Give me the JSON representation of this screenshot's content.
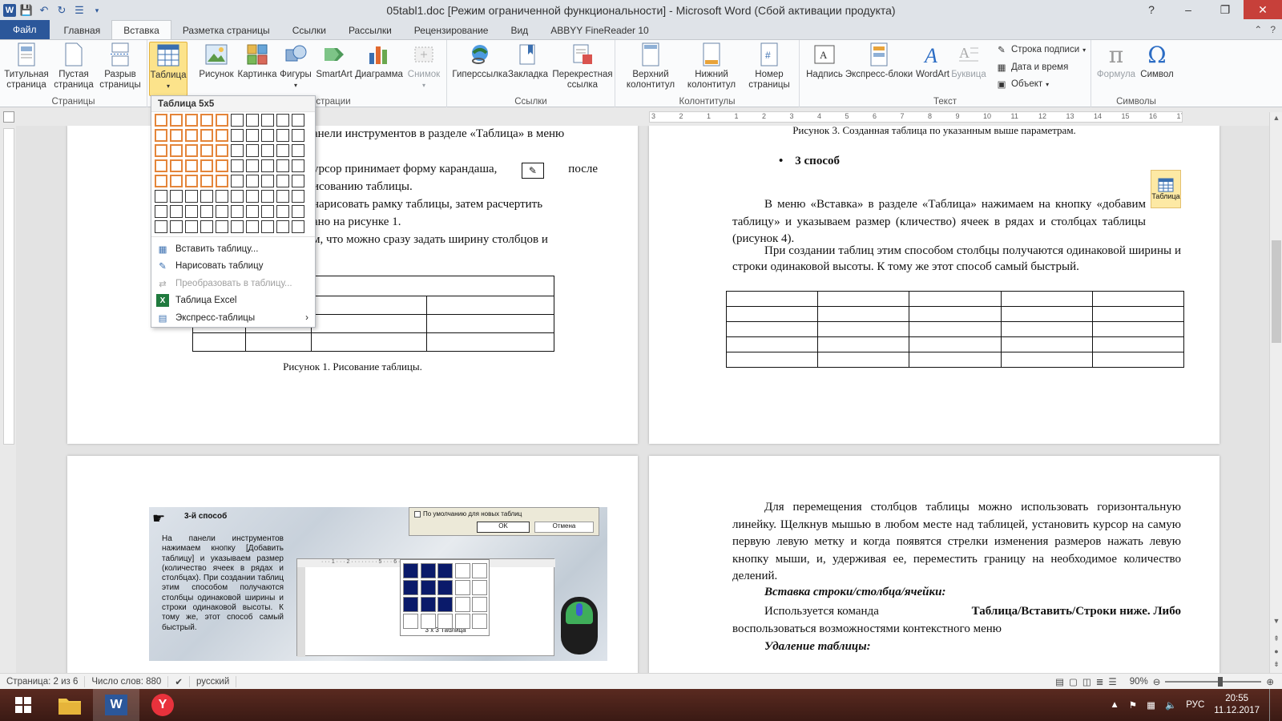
{
  "window": {
    "title": "05tabl1.doc [Режим ограниченной функциональности] - Microsoft Word (Сбой активации продукта)",
    "controls": [
      "?",
      "–",
      "❐",
      "✕"
    ]
  },
  "qat": {
    "logo": "W"
  },
  "tabs": [
    {
      "label": "Файл",
      "kind": "file"
    },
    {
      "label": "Главная",
      "kind": "normal"
    },
    {
      "label": "Вставка",
      "kind": "active"
    },
    {
      "label": "Разметка страницы",
      "kind": "normal"
    },
    {
      "label": "Ссылки",
      "kind": "normal"
    },
    {
      "label": "Рассылки",
      "kind": "normal"
    },
    {
      "label": "Рецензирование",
      "kind": "normal"
    },
    {
      "label": "Вид",
      "kind": "normal"
    },
    {
      "label": "ABBYY FineReader 10",
      "kind": "normal"
    }
  ],
  "ribbon": {
    "groups": {
      "pages": "Страницы",
      "illustrations": "страции",
      "links": "Ссылки",
      "headers": "Колонтитулы",
      "text": "Текст",
      "symbols": "Символы"
    },
    "buttons": {
      "title_page": "Титульная страница",
      "blank_page": "Пустая страница",
      "page_break": "Разрыв страницы",
      "table": "Таблица",
      "picture": "Рисунок",
      "clipart": "Картинка",
      "shapes": "Фигуры",
      "smartart": "SmartArt",
      "chart": "Диаграмма",
      "screenshot": "Снимок",
      "hyperlink": "Гиперссылка",
      "bookmark": "Закладка",
      "cross_ref": "Перекрестная ссылка",
      "header": "Верхний колонтитул",
      "footer": "Нижний колонтитул",
      "page_number": "Номер страницы",
      "textbox": "Надпись",
      "quick_parts": "Экспресс-блоки",
      "wordart": "WordArt",
      "dropcap": "Буквица",
      "signature_line": "Строка подписи",
      "datetime": "Дата и время",
      "object": "Объект",
      "equation": "Формула",
      "symbol": "Символ"
    }
  },
  "ruler": {
    "ticks": [
      "3",
      "2",
      "1",
      "1",
      "2",
      "3",
      "4",
      "5",
      "6",
      "7",
      "8",
      "9",
      "10",
      "11",
      "12",
      "13",
      "14",
      "15",
      "16",
      "17"
    ]
  },
  "table_dropdown": {
    "title": "Таблица 5x5",
    "grid_cols": 10,
    "grid_rows": 8,
    "selected_cols": 5,
    "selected_rows": 5,
    "items": [
      {
        "label": "Вставить таблицу...",
        "icon": "insert-table-icon",
        "disabled": false
      },
      {
        "label": "Нарисовать таблицу",
        "icon": "draw-table-icon",
        "disabled": false
      },
      {
        "label": "Преобразовать в таблицу...",
        "icon": "convert-table-icon",
        "disabled": true
      },
      {
        "label": "Таблица Excel",
        "icon": "excel-icon",
        "disabled": false
      },
      {
        "label": "Экспресс-таблицы",
        "icon": "quick-tables-icon",
        "disabled": false,
        "submenu": true
      }
    ]
  },
  "page1": {
    "line1": "анели инструментов в разделе «Таблица» в меню",
    "line2": "урсор принимает форму карандаша,",
    "line2b": "после",
    "line3": "исованию таблицы.",
    "line4": "нарисовать рамку таблицы, затем расчертить",
    "line5": "ано на рисунке 1.",
    "line6": "м, что можно сразу задать ширину столбцов и",
    "caption": "Рисунок 1. Рисование таблицы."
  },
  "page2": {
    "caption_top": "Рисунок 3. Созданная таблица по указанным выше параметрам.",
    "bullet": "3 способ",
    "para1": "В меню «Вставка» в разделе «Таблица» нажимаем на кнопку «добавим таблицу» и указываем размер (кличество) ячеек в рядах и столбцах таблицы (рисунок 4).",
    "para2": "При создании таблиц этим способом столбцы получаются одинаковой ширины и строки одинаковой высоты. К тому же этот способ самый быстрый.",
    "table_icon_label": "Таблица"
  },
  "page3": {
    "scan_title": "3-й способ",
    "scan_text": "На панели инструментов нажимаем кнопку [Добавить таблицу] и указываем размер (количество ячеек в рядах и столбцах). При создании таблиц этим способом получаются столбцы одинаковой ширины и строки одинаковой высоты. К тому же, этот способ самый быстрый.",
    "scan_checkbox": "По умолчанию для новых таблиц",
    "scan_ok": "OK",
    "scan_cancel": "Отмена",
    "scan_grid_label": "3 х 3 Таблица"
  },
  "page4": {
    "para1": "Для перемещения столбцов таблицы можно использовать горизонтальную линейку. Щелкнув мышью в любом месте над таблицей, установить курсор на самую первую левую метку и когда появятся стрелки изменения размеров нажать левую кнопку мыши, и, удерживая ее, переместить границу на необходимое количество делений.",
    "heading1": "Вставка строки/столбца/ячейки:",
    "para2a": "Используется команда",
    "para2b": "Таблица/Вставить/Строки ниже. Либо",
    "para2c": "воспользоваться возможностями контекстного меню",
    "heading2": "Удаление таблицы:"
  },
  "status": {
    "page": "Страница: 2 из 6",
    "words": "Число слов: 880",
    "lang": "русский",
    "zoom": "90%"
  },
  "taskbar": {
    "lang": "РУС",
    "time": "20:55",
    "date": "11.12.2017"
  }
}
